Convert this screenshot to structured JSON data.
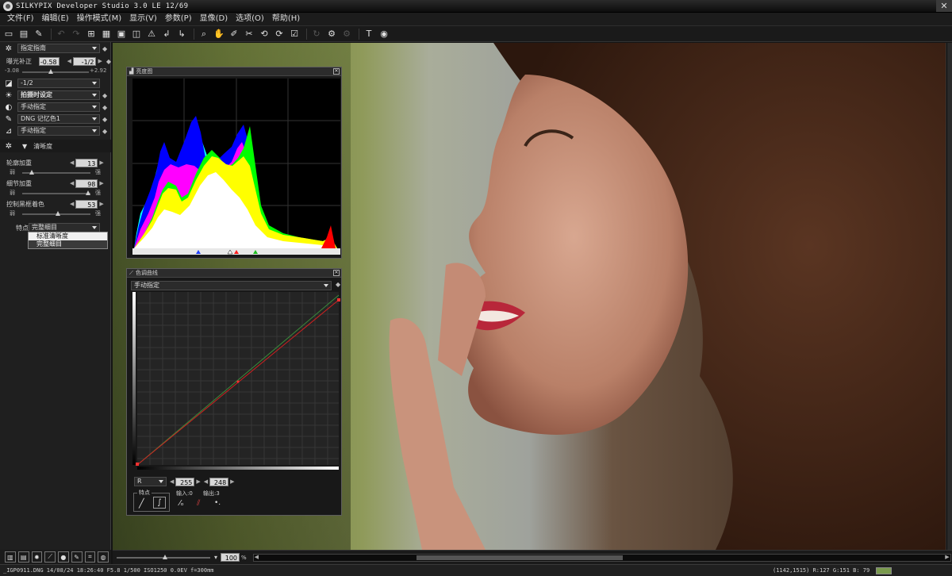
{
  "window": {
    "title": "SILKYPIX Developer Studio 3.0 LE   12/69"
  },
  "menu": [
    "文件(F)",
    "编辑(E)",
    "操作模式(M)",
    "显示(V)",
    "参数(P)",
    "显像(D)",
    "选项(O)",
    "帮助(H)"
  ],
  "toolbar_icons": [
    "open-folder-icon",
    "open-file-icon",
    "dropper-icon",
    "undo-icon",
    "redo-icon",
    "grid-view-icon",
    "filmstrip-view-icon",
    "single-view-icon",
    "compare-view-icon",
    "warning-icon",
    "rotate-left-icon",
    "rotate-right-icon",
    "zoom-icon",
    "hand-icon",
    "gray-point-icon",
    "crop-icon",
    "rotate-ccw-icon",
    "rotate-cw-icon",
    "checkbox-icon",
    "refresh-icon",
    "develop-icon",
    "develop-all-icon",
    "brush-icon",
    "help-icon"
  ],
  "left_panel": {
    "preset": "指定指南",
    "exposure_label": "曝光补正",
    "exposure_value": "-0.58",
    "exposure_step": "-1/2",
    "exposure_min": "-3.08",
    "exposure_max": "+2.92",
    "contrast_value": "-1/2",
    "white_balance": "拍摄时设定",
    "tone": "手动指定",
    "color": "DNG 记忆色1",
    "sharpness_mode": "手动指定",
    "section_title": "清晰度",
    "outline_label": "轮廓加重",
    "outline_value": "13",
    "detail_label": "细节加重",
    "detail_value": "98",
    "halo_label": "控制黑框着色",
    "halo_value": "53",
    "weak": "弱",
    "strong": "强",
    "feature_label": "特点",
    "feature_value": "完整细目",
    "dropdown_options": [
      "标准清晰度",
      "完整细目"
    ]
  },
  "histogram": {
    "title": "亮度图"
  },
  "curve": {
    "title": "色调曲线",
    "mode": "手动指定",
    "channel": "R",
    "input_value": "255",
    "output_value": "248",
    "feature_label": "特点",
    "input_label": "输入:0",
    "output_label": "输出:3"
  },
  "zoom_value": "100",
  "zoom_unit": "%",
  "status": {
    "file_info": "_IGP0911.DNG 14/08/24 18:26:40 F5.8 1/500 ISO1250 0.0EV f=300mm",
    "pixel_info": "(1142,1515) R:127 G:151 B: 79",
    "swatch_color": "#7a9a4e"
  }
}
